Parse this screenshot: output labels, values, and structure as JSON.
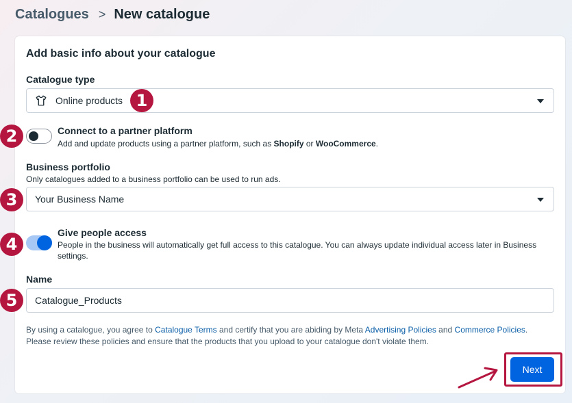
{
  "breadcrumb": {
    "parent": "Catalogues",
    "separator": ">",
    "current": "New catalogue"
  },
  "card": {
    "title": "Add basic info about your catalogue"
  },
  "catalogue_type": {
    "label": "Catalogue type",
    "value": "Online products",
    "icon": "t-shirt-icon"
  },
  "partner_platform": {
    "title": "Connect to a partner platform",
    "desc_prefix": "Add and update products using a partner platform, such as ",
    "shopify": "Shopify",
    "or": " or ",
    "woocommerce": "WooCommerce",
    "desc_suffix": ".",
    "enabled": false
  },
  "business_portfolio": {
    "label": "Business portfolio",
    "helper": "Only catalogues added to a business portfolio can be used to run ads.",
    "value": "Your Business Name"
  },
  "people_access": {
    "title": "Give people access",
    "desc": "People in the business will automatically get full access to this catalogue. You can always update individual access later in Business settings.",
    "enabled": true
  },
  "name": {
    "label": "Name",
    "value": "Catalogue_Products"
  },
  "terms": {
    "t1": "By using a catalogue, you agree to ",
    "link_terms": "Catalogue Terms",
    "t2": " and certify that you are abiding by Meta ",
    "link_ads": "Advertising Policies",
    "t3": " and ",
    "link_commerce": "Commerce Policies",
    "t4": ".",
    "t5": "Please review these policies and ensure that the products that you upload to your catalogue don't violate them."
  },
  "next_label": "Next",
  "markers": [
    "1",
    "2",
    "3",
    "4",
    "5"
  ],
  "colors": {
    "accent": "#0064e0",
    "annotation": "#b5163f"
  }
}
